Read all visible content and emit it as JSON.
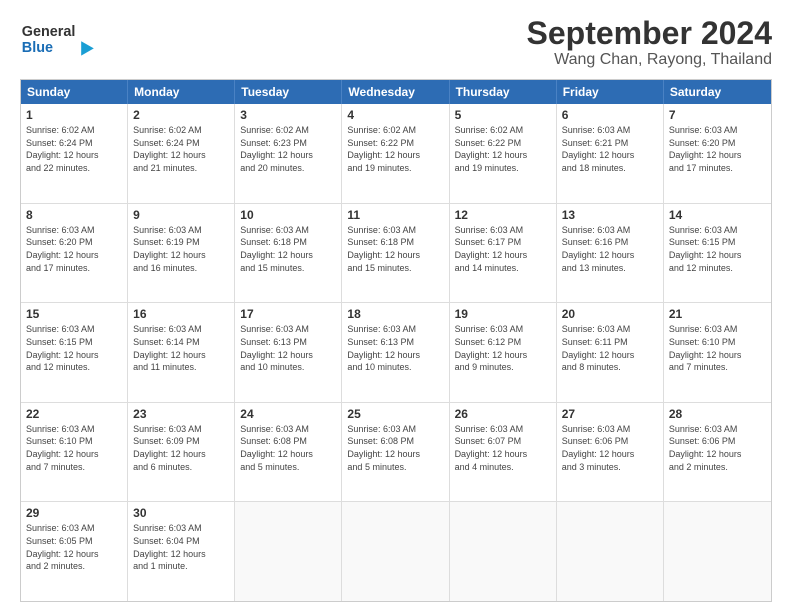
{
  "header": {
    "logo_line1": "General",
    "logo_line2": "Blue",
    "title": "September 2024",
    "subtitle": "Wang Chan, Rayong, Thailand"
  },
  "calendar": {
    "days_of_week": [
      "Sunday",
      "Monday",
      "Tuesday",
      "Wednesday",
      "Thursday",
      "Friday",
      "Saturday"
    ],
    "weeks": [
      [
        {
          "day": "",
          "empty": true
        },
        {
          "day": "",
          "empty": true
        },
        {
          "day": "",
          "empty": true
        },
        {
          "day": "",
          "empty": true
        },
        {
          "day": "",
          "empty": true
        },
        {
          "day": "",
          "empty": true
        },
        {
          "day": "",
          "empty": true
        }
      ],
      [
        {
          "day": "1",
          "info": "Sunrise: 6:02 AM\nSunset: 6:24 PM\nDaylight: 12 hours\nand 22 minutes."
        },
        {
          "day": "2",
          "info": "Sunrise: 6:02 AM\nSunset: 6:24 PM\nDaylight: 12 hours\nand 21 minutes."
        },
        {
          "day": "3",
          "info": "Sunrise: 6:02 AM\nSunset: 6:23 PM\nDaylight: 12 hours\nand 20 minutes."
        },
        {
          "day": "4",
          "info": "Sunrise: 6:02 AM\nSunset: 6:22 PM\nDaylight: 12 hours\nand 19 minutes."
        },
        {
          "day": "5",
          "info": "Sunrise: 6:02 AM\nSunset: 6:22 PM\nDaylight: 12 hours\nand 19 minutes."
        },
        {
          "day": "6",
          "info": "Sunrise: 6:03 AM\nSunset: 6:21 PM\nDaylight: 12 hours\nand 18 minutes."
        },
        {
          "day": "7",
          "info": "Sunrise: 6:03 AM\nSunset: 6:20 PM\nDaylight: 12 hours\nand 17 minutes."
        }
      ],
      [
        {
          "day": "8",
          "info": "Sunrise: 6:03 AM\nSunset: 6:20 PM\nDaylight: 12 hours\nand 17 minutes."
        },
        {
          "day": "9",
          "info": "Sunrise: 6:03 AM\nSunset: 6:19 PM\nDaylight: 12 hours\nand 16 minutes."
        },
        {
          "day": "10",
          "info": "Sunrise: 6:03 AM\nSunset: 6:18 PM\nDaylight: 12 hours\nand 15 minutes."
        },
        {
          "day": "11",
          "info": "Sunrise: 6:03 AM\nSunset: 6:18 PM\nDaylight: 12 hours\nand 15 minutes."
        },
        {
          "day": "12",
          "info": "Sunrise: 6:03 AM\nSunset: 6:17 PM\nDaylight: 12 hours\nand 14 minutes."
        },
        {
          "day": "13",
          "info": "Sunrise: 6:03 AM\nSunset: 6:16 PM\nDaylight: 12 hours\nand 13 minutes."
        },
        {
          "day": "14",
          "info": "Sunrise: 6:03 AM\nSunset: 6:15 PM\nDaylight: 12 hours\nand 12 minutes."
        }
      ],
      [
        {
          "day": "15",
          "info": "Sunrise: 6:03 AM\nSunset: 6:15 PM\nDaylight: 12 hours\nand 12 minutes."
        },
        {
          "day": "16",
          "info": "Sunrise: 6:03 AM\nSunset: 6:14 PM\nDaylight: 12 hours\nand 11 minutes."
        },
        {
          "day": "17",
          "info": "Sunrise: 6:03 AM\nSunset: 6:13 PM\nDaylight: 12 hours\nand 10 minutes."
        },
        {
          "day": "18",
          "info": "Sunrise: 6:03 AM\nSunset: 6:13 PM\nDaylight: 12 hours\nand 10 minutes."
        },
        {
          "day": "19",
          "info": "Sunrise: 6:03 AM\nSunset: 6:12 PM\nDaylight: 12 hours\nand 9 minutes."
        },
        {
          "day": "20",
          "info": "Sunrise: 6:03 AM\nSunset: 6:11 PM\nDaylight: 12 hours\nand 8 minutes."
        },
        {
          "day": "21",
          "info": "Sunrise: 6:03 AM\nSunset: 6:10 PM\nDaylight: 12 hours\nand 7 minutes."
        }
      ],
      [
        {
          "day": "22",
          "info": "Sunrise: 6:03 AM\nSunset: 6:10 PM\nDaylight: 12 hours\nand 7 minutes."
        },
        {
          "day": "23",
          "info": "Sunrise: 6:03 AM\nSunset: 6:09 PM\nDaylight: 12 hours\nand 6 minutes."
        },
        {
          "day": "24",
          "info": "Sunrise: 6:03 AM\nSunset: 6:08 PM\nDaylight: 12 hours\nand 5 minutes."
        },
        {
          "day": "25",
          "info": "Sunrise: 6:03 AM\nSunset: 6:08 PM\nDaylight: 12 hours\nand 5 minutes."
        },
        {
          "day": "26",
          "info": "Sunrise: 6:03 AM\nSunset: 6:07 PM\nDaylight: 12 hours\nand 4 minutes."
        },
        {
          "day": "27",
          "info": "Sunrise: 6:03 AM\nSunset: 6:06 PM\nDaylight: 12 hours\nand 3 minutes."
        },
        {
          "day": "28",
          "info": "Sunrise: 6:03 AM\nSunset: 6:06 PM\nDaylight: 12 hours\nand 2 minutes."
        }
      ],
      [
        {
          "day": "29",
          "info": "Sunrise: 6:03 AM\nSunset: 6:05 PM\nDaylight: 12 hours\nand 2 minutes."
        },
        {
          "day": "30",
          "info": "Sunrise: 6:03 AM\nSunset: 6:04 PM\nDaylight: 12 hours\nand 1 minute."
        },
        {
          "day": "",
          "empty": true
        },
        {
          "day": "",
          "empty": true
        },
        {
          "day": "",
          "empty": true
        },
        {
          "day": "",
          "empty": true
        },
        {
          "day": "",
          "empty": true
        }
      ]
    ]
  }
}
